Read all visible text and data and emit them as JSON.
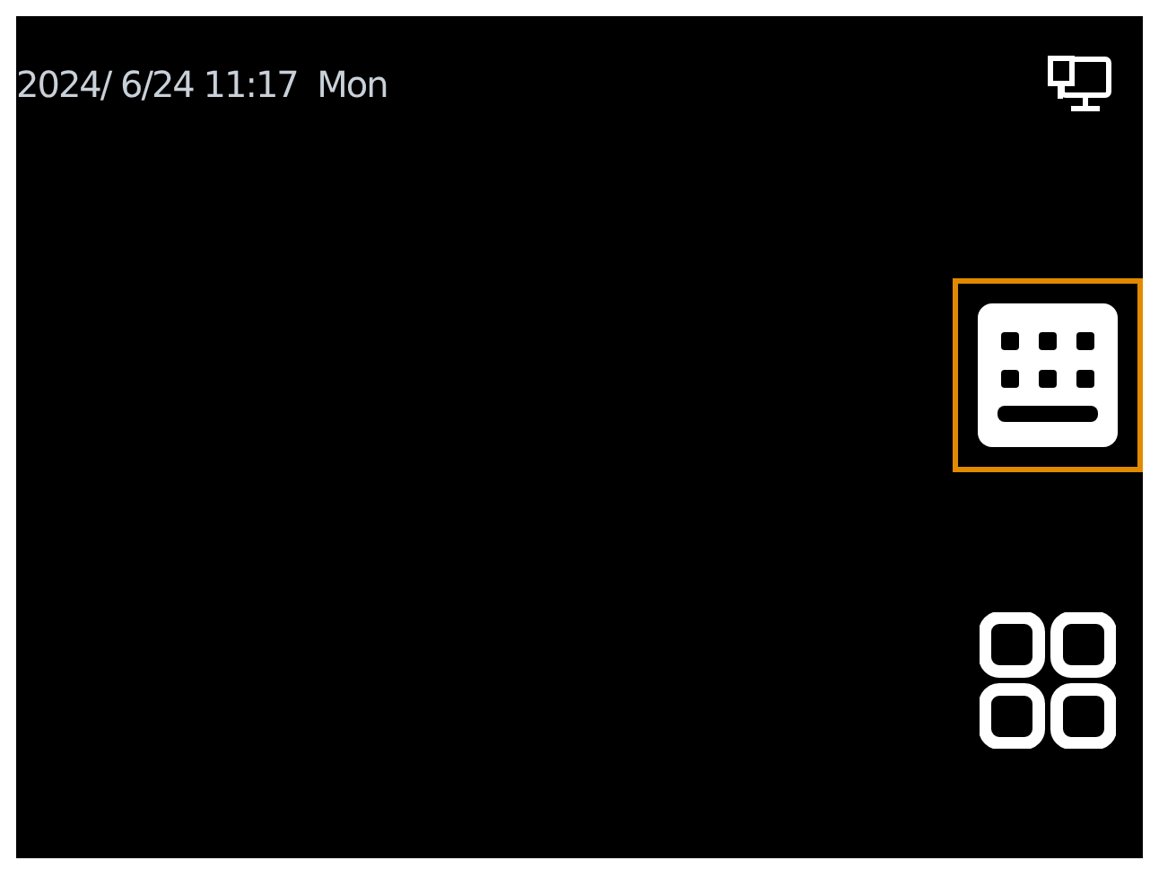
{
  "status_bar": {
    "datetime": "2024/ 6/24 11:17  Mon"
  },
  "side_buttons": [
    {
      "kind": "keyboard",
      "selected": true
    },
    {
      "kind": "apps",
      "selected": false
    }
  ]
}
